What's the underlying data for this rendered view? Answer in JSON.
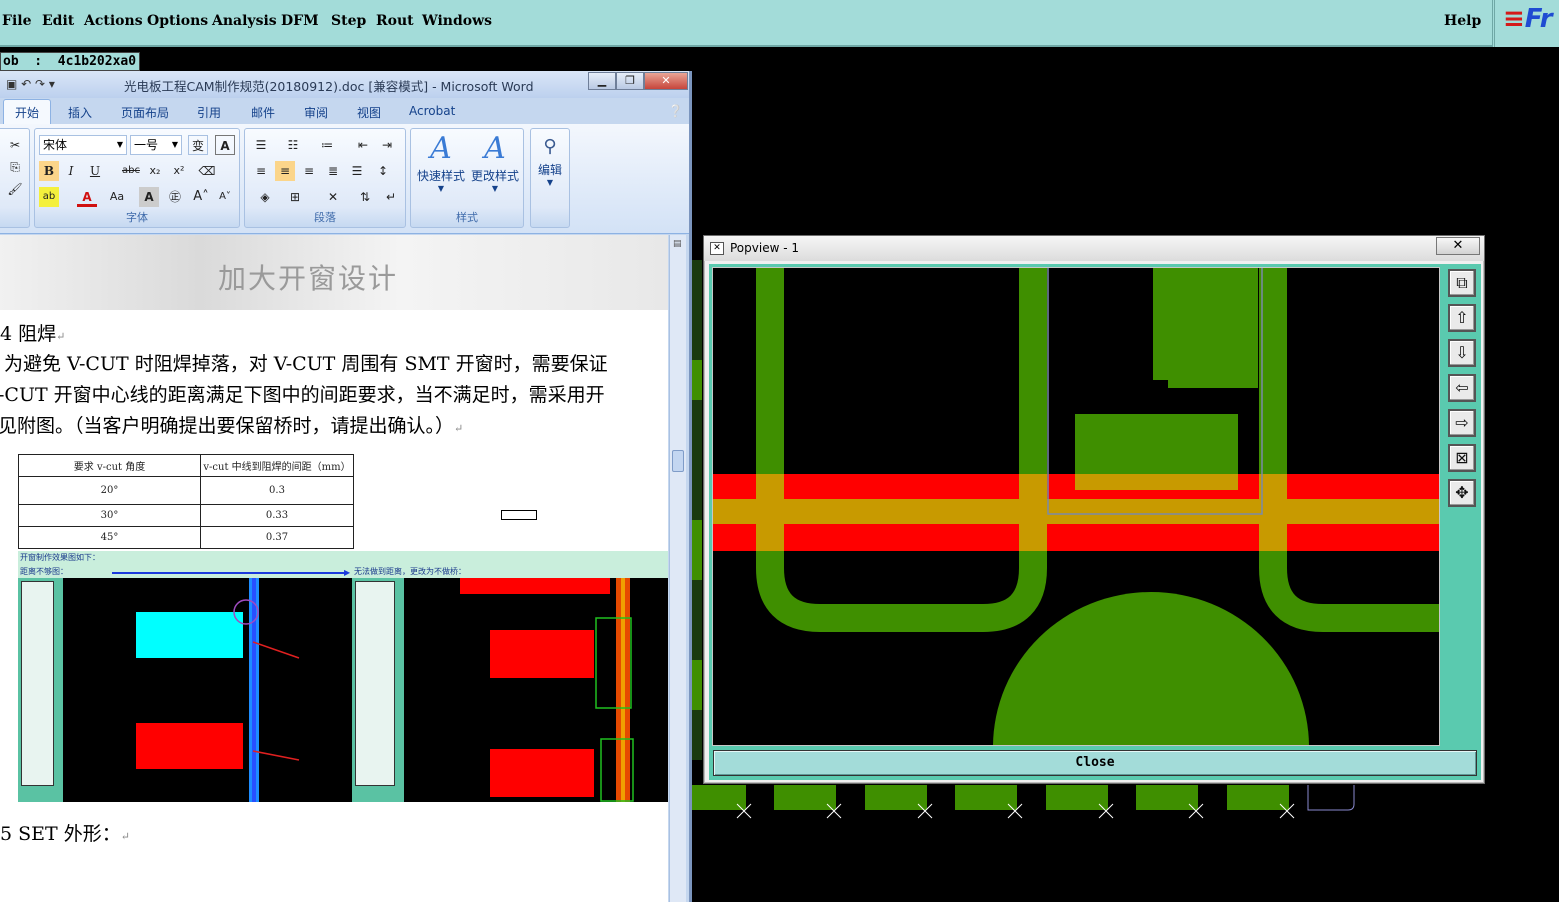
{
  "cam": {
    "menu": [
      "File",
      "Edit",
      "Actions",
      "Options",
      "Analysis",
      "DFM",
      "Step",
      "Rout",
      "Windows"
    ],
    "help": "Help",
    "logo_text": "Fr",
    "job_label": "ob  :  4c1b202xa0"
  },
  "word": {
    "title": "光电板工程CAM制作规范(20180912).doc [兼容模式] - Microsoft Word",
    "tabs": [
      "开始",
      "插入",
      "页面布局",
      "引用",
      "邮件",
      "审阅",
      "视图",
      "Acrobat"
    ],
    "font_name": "宋体",
    "font_size": "一号",
    "groups": {
      "font": "字体",
      "paragraph": "段落",
      "styles": "样式"
    },
    "big_buttons": {
      "quick_styles": "快速样式",
      "change_styles": "更改样式",
      "edit": "编辑"
    },
    "doc": {
      "banner": "加大开窗设计",
      "heading_4": "4  阻焊",
      "para_line1": "  为避免 V-CUT 时阻焊掉落，对 V-CUT 周围有 SMT 开窗时，需要保证",
      "para_line2": "-CUT  开窗中心线的距离满足下图中的间距要求，当不满足时，需采用开",
      "para_line3": "见附图。（当客户明确提出要保留桥时，请提出确认。）",
      "table_headers": [
        "要求 v-cut 角度",
        "v-cut 中线到阻焊的间距（mm）"
      ],
      "table_rows": [
        [
          "20°",
          "0.3"
        ],
        [
          "30°",
          "0.33"
        ],
        [
          "45°",
          "0.37"
        ]
      ],
      "img_caption": "开窗制作效果图如下：",
      "img_left_label": "距离不够图：",
      "img_right_label": "无法做到距离，更改为不做桥：",
      "heading_5": "5 SET 外形："
    }
  },
  "popview": {
    "title": "Popview - 1",
    "close_x": "✕",
    "close_button": "Close",
    "colors": {
      "copper": "#3f8f00",
      "red": "#ff0000",
      "overlap": "#c89a00",
      "panel": "#5acaaf"
    }
  }
}
